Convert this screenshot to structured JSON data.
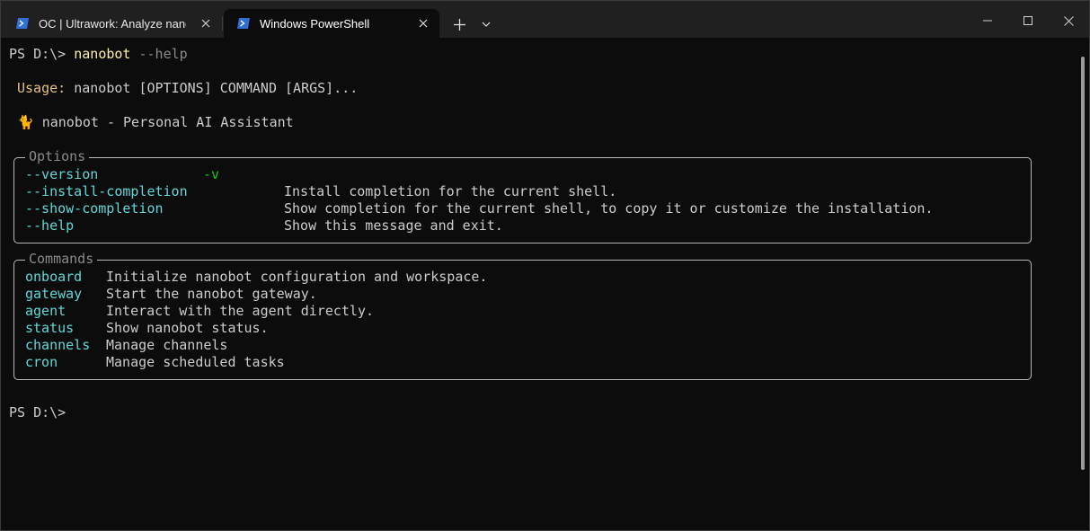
{
  "tabs": [
    {
      "title": "OC | Ultrawork: Analyze nanobot",
      "active": false
    },
    {
      "title": "Windows PowerShell",
      "active": true
    }
  ],
  "prompt": "PS D:\\>",
  "command": {
    "name": "nanobot",
    "flag": "--help"
  },
  "usage": {
    "label": "Usage:",
    "text": "nanobot [OPTIONS] COMMAND [ARGS]..."
  },
  "tagline": {
    "emoji": "🐈",
    "text": "nanobot - Personal AI Assistant"
  },
  "options": {
    "title": "Options",
    "items": [
      {
        "flag": "--version",
        "short": "-v",
        "description": ""
      },
      {
        "flag": "--install-completion",
        "short": "",
        "description": "Install completion for the current shell."
      },
      {
        "flag": "--show-completion",
        "short": "",
        "description": "Show completion for the current shell, to copy it or customize the installation."
      },
      {
        "flag": "--help",
        "short": "",
        "description": "Show this message and exit."
      }
    ]
  },
  "commands": {
    "title": "Commands",
    "items": [
      {
        "name": "onboard",
        "description": "Initialize nanobot configuration and workspace."
      },
      {
        "name": "gateway",
        "description": "Start the nanobot gateway."
      },
      {
        "name": "agent",
        "description": "Interact with the agent directly."
      },
      {
        "name": "status",
        "description": "Show nanobot status."
      },
      {
        "name": "channels",
        "description": "Manage channels"
      },
      {
        "name": "cron",
        "description": "Manage scheduled tasks"
      }
    ]
  },
  "final_prompt": "PS D:\\>",
  "colors": {
    "background": "#0c0c0c",
    "titlebar": "#202020",
    "text": "#cccccc",
    "command": "#f9f1a5",
    "usage_label": "#e5c07b",
    "option_flag": "#61d6d6",
    "short_flag": "#16c60c",
    "dim": "#8a8a8a"
  }
}
